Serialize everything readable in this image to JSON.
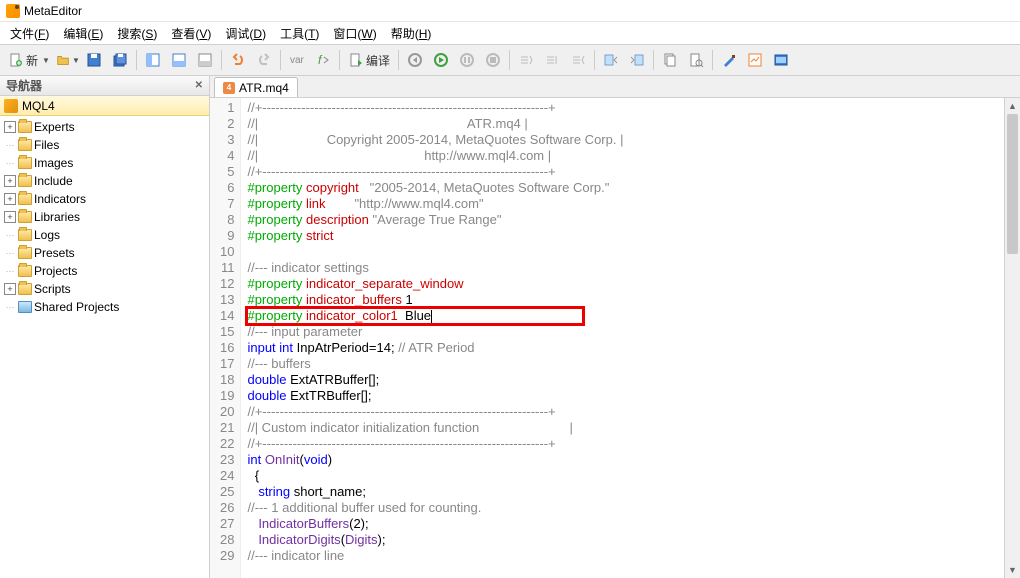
{
  "title": "MetaEditor",
  "menu": [
    {
      "label": "文件",
      "key": "F"
    },
    {
      "label": "编辑",
      "key": "E"
    },
    {
      "label": "搜索",
      "key": "S"
    },
    {
      "label": "查看",
      "key": "V"
    },
    {
      "label": "调试",
      "key": "D"
    },
    {
      "label": "工具",
      "key": "T"
    },
    {
      "label": "窗口",
      "key": "W"
    },
    {
      "label": "帮助",
      "key": "H"
    }
  ],
  "toolbar": {
    "new_label": "新",
    "compile_label": "编译"
  },
  "navigator": {
    "title": "导航器",
    "root": "MQL4",
    "items": [
      {
        "label": "Experts",
        "exp": "+"
      },
      {
        "label": "Files",
        "exp": ""
      },
      {
        "label": "Images",
        "exp": ""
      },
      {
        "label": "Include",
        "exp": "+"
      },
      {
        "label": "Indicators",
        "exp": "+"
      },
      {
        "label": "Libraries",
        "exp": "+"
      },
      {
        "label": "Logs",
        "exp": ""
      },
      {
        "label": "Presets",
        "exp": ""
      },
      {
        "label": "Projects",
        "exp": ""
      },
      {
        "label": "Scripts",
        "exp": "+"
      },
      {
        "label": "Shared Projects",
        "exp": "",
        "shared": true
      }
    ]
  },
  "tab": {
    "name": "ATR.mq4"
  },
  "code": {
    "lines": [
      {
        "n": 1,
        "html": "<span class='c-com'>//+------------------------------------------------------------------+</span>"
      },
      {
        "n": 2,
        "html": "<span class='c-com'>//|                                                          ATR.mq4 |</span>"
      },
      {
        "n": 3,
        "html": "<span class='c-com'>//|                   Copyright 2005-2014, MetaQuotes Software Corp. |</span>"
      },
      {
        "n": 4,
        "html": "<span class='c-com'>//|                                              http://www.mql4.com |</span>"
      },
      {
        "n": 5,
        "html": "<span class='c-com'>//+------------------------------------------------------------------+</span>"
      },
      {
        "n": 6,
        "html": "<span class='c-pp'>#property</span> <span class='c-pn'>copyright</span>   <span class='c-str'>\"2005-2014, MetaQuotes Software Corp.\"</span>"
      },
      {
        "n": 7,
        "html": "<span class='c-pp'>#property</span> <span class='c-pn'>link</span>        <span class='c-str'>\"http://www.mql4.com\"</span>"
      },
      {
        "n": 8,
        "html": "<span class='c-pp'>#property</span> <span class='c-pn'>description</span> <span class='c-str'>\"Average True Range\"</span>"
      },
      {
        "n": 9,
        "html": "<span class='c-pp'>#property</span> <span class='c-pn'>strict</span>"
      },
      {
        "n": 10,
        "html": ""
      },
      {
        "n": 11,
        "html": "<span class='c-com'>//--- indicator settings</span>"
      },
      {
        "n": 12,
        "html": "<span class='c-pp'>#property</span> <span class='c-pn'>indicator_separate_window</span>"
      },
      {
        "n": 13,
        "html": "<span class='c-pp'>#property</span> <span class='c-pn'>indicator_buffers</span> 1"
      },
      {
        "n": 14,
        "html": "<span class='c-pp'>#property</span> <span class='c-pn'>indicator_color1</span>  Blue<span class='caret'></span>",
        "hl": true
      },
      {
        "n": 15,
        "html": "<span class='c-com'>//--- input parameter</span>"
      },
      {
        "n": 16,
        "html": "<span class='c-kw'>input</span> <span class='c-type'>int</span> InpAtrPeriod=14; <span class='c-com'>// ATR Period</span>"
      },
      {
        "n": 17,
        "html": "<span class='c-com'>//--- buffers</span>"
      },
      {
        "n": 18,
        "html": "<span class='c-type'>double</span> ExtATRBuffer[];"
      },
      {
        "n": 19,
        "html": "<span class='c-type'>double</span> ExtTRBuffer[];"
      },
      {
        "n": 20,
        "html": "<span class='c-com'>//+------------------------------------------------------------------+</span>"
      },
      {
        "n": 21,
        "html": "<span class='c-com'>//| Custom indicator initialization function                         |</span>"
      },
      {
        "n": 22,
        "html": "<span class='c-com'>//+------------------------------------------------------------------+</span>"
      },
      {
        "n": 23,
        "html": "<span class='c-type'>int</span> <span class='c-func'>OnInit</span>(<span class='c-type'>void</span>)"
      },
      {
        "n": 24,
        "html": "  {"
      },
      {
        "n": 25,
        "html": "   <span class='c-type'>string</span> short_name;"
      },
      {
        "n": 26,
        "html": "<span class='c-com'>//--- 1 additional buffer used for counting.</span>"
      },
      {
        "n": 27,
        "html": "   <span class='c-func'>IndicatorBuffers</span>(2);"
      },
      {
        "n": 28,
        "html": "   <span class='c-func'>IndicatorDigits</span>(<span class='c-func'>Digits</span>);"
      },
      {
        "n": 29,
        "html": "<span class='c-com'>//--- indicator line</span>"
      }
    ]
  }
}
